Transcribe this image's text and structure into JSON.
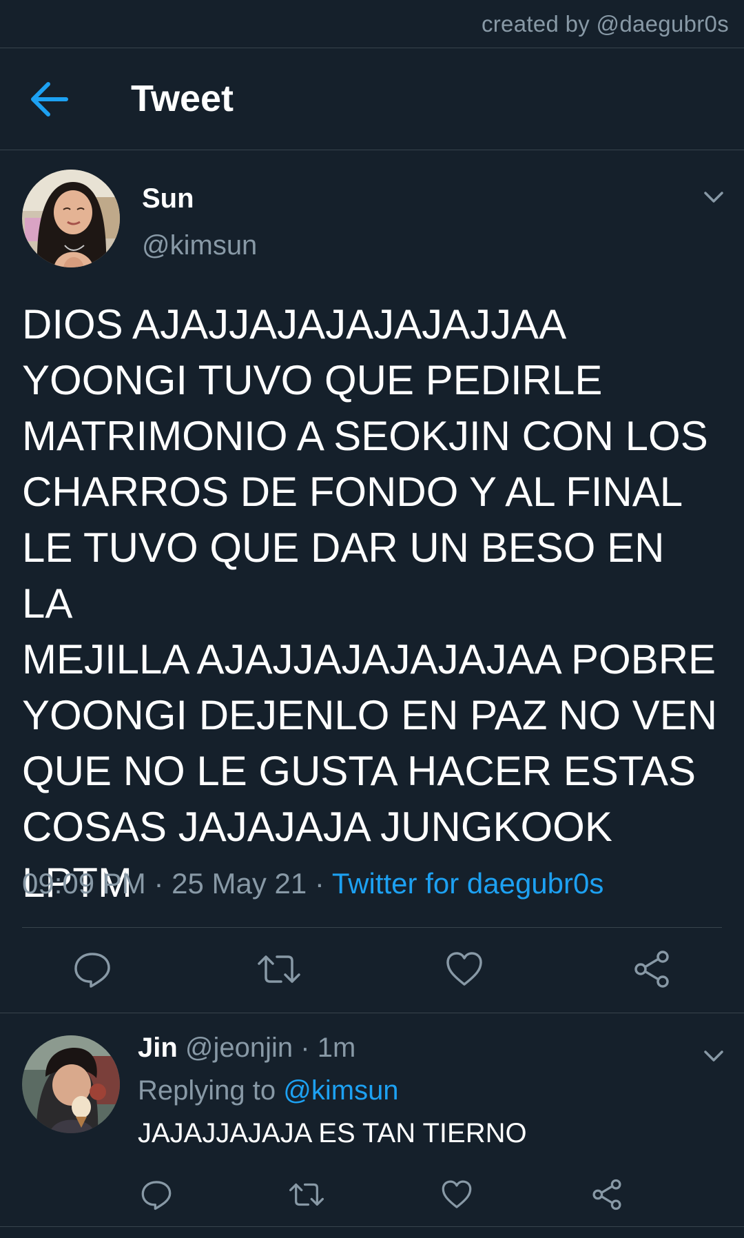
{
  "credit": {
    "text": "created by @daegubr0s"
  },
  "header": {
    "title": "Tweet",
    "back_icon": "arrow-left-icon"
  },
  "tweet": {
    "author": {
      "name": "Sun",
      "handle": "@kimsun"
    },
    "text": "DIOS AJAJJAJAJAJAJAJJAA\nYOONGI TUVO QUE PEDIRLE\nMATRIMONIO A SEOKJIN CON LOS\nCHARROS DE FONDO Y AL FINAL\nLE TUVO QUE DAR UN BESO EN LA\nMEJILLA AJAJJAJAJAJAJAA POBRE\nYOONGI DEJENLO EN PAZ NO VEN\nQUE NO LE GUSTA HACER ESTAS\nCOSAS JAJAJAJA JUNGKOOK\nLPTM",
    "time": "09:09 PM",
    "separator": "·",
    "date": "25 May 21",
    "source": "Twitter for daegubr0s",
    "actions": [
      "comment-icon",
      "retweet-icon",
      "heart-icon",
      "share-icon"
    ]
  },
  "reply": {
    "author": {
      "name": "Jin",
      "handle": "@jeonjin"
    },
    "separator": "·",
    "time": "1m",
    "replying_to_label": "Replying to",
    "replying_to_handle": "@kimsun",
    "text": "JAJAJJAJAJA ES TAN TIERNO",
    "actions": [
      "comment-icon",
      "retweet-icon",
      "heart-icon",
      "share-icon"
    ]
  },
  "colors": {
    "background": "#15202b",
    "divider": "#38444d",
    "secondary_text": "#8899a6",
    "accent": "#1da1f2",
    "primary_text": "#ffffff"
  }
}
